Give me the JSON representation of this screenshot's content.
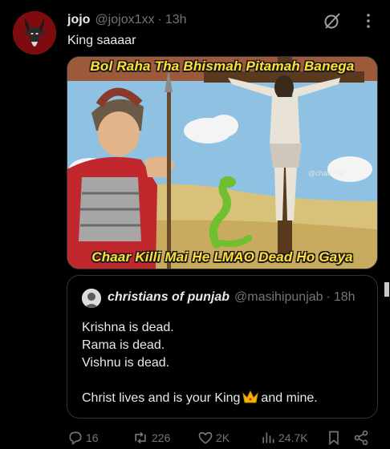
{
  "tweet": {
    "author_name": "jojo",
    "author_handle": "@jojox1xx",
    "separator": "·",
    "time": "13h",
    "text": "King saaaar",
    "media": {
      "caption_top": "Bol Raha Tha Bhismah Pitamah Banega",
      "caption_bottom": "Chaar Killi Mai He LMAO Dead Ho Gaya",
      "watermark": "@chad_mil"
    }
  },
  "quoted_tweet": {
    "author_name": "christians of punjab",
    "author_handle": "@masihipunjab",
    "separator": "·",
    "time": "18h",
    "lines": [
      "Krishna is dead.",
      "Rama is dead.",
      "Vishnu is dead.",
      ""
    ],
    "last_line_before": "Christ lives and is your King",
    "last_line_after": "and mine."
  },
  "actions": {
    "replies": "16",
    "reposts": "226",
    "likes": "2K",
    "views": "24.7K"
  },
  "icons": [
    "grok-icon",
    "more-icon",
    "reply-icon",
    "repost-icon",
    "like-icon",
    "views-icon",
    "bookmark-icon",
    "share-icon",
    "crown-icon"
  ],
  "colors": {
    "background": "#000000",
    "text": "#e7e9ea",
    "muted": "#71767b",
    "border": "#2f3336",
    "caption": "#ffe033"
  }
}
